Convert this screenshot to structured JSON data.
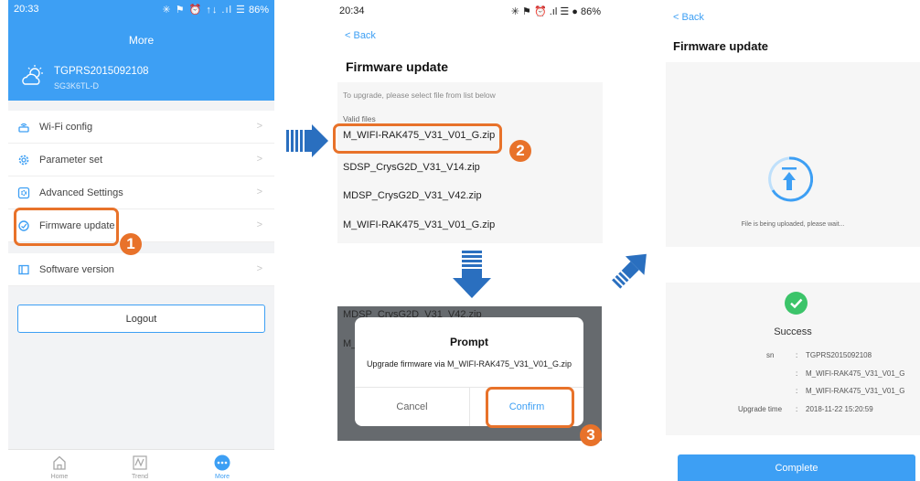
{
  "panel1": {
    "status": {
      "time": "20:33",
      "icons": "✳ ⚑ ⏰ ↑↓ .ıl ☰",
      "battery": "86%"
    },
    "title": "More",
    "device": {
      "sn": "TGPRS2015092108",
      "model": "SG3K6TL-D"
    },
    "menu": [
      {
        "label": "Wi-Fi config",
        "icon": "wifi-router-icon"
      },
      {
        "label": "Parameter set",
        "icon": "gear-icon"
      },
      {
        "label": "Advanced Settings",
        "icon": "advanced-gear-icon"
      },
      {
        "label": "Firmware update",
        "icon": "firmware-icon"
      }
    ],
    "software_version": "Software version",
    "logout": "Logout",
    "tabs": [
      {
        "label": "Home",
        "icon": "home-icon"
      },
      {
        "label": "Trend",
        "icon": "trend-icon"
      },
      {
        "label": "More",
        "icon": "more-icon"
      }
    ],
    "chevron": ">"
  },
  "panel2": {
    "status": {
      "time": "20:34",
      "icons": "✳ ⚑ ⏰ .ıl ☰ ●",
      "battery": "86%"
    },
    "back": "<  Back",
    "title": "Firmware update",
    "hint": "To upgrade, please select file from list below",
    "valid_files": "Valid files",
    "files": [
      "M_WIFI-RAK475_V31_V01_G.zip",
      "SDSP_CrysG2D_V31_V14.zip",
      "MDSP_CrysG2D_V31_V42.zip",
      "M_WIFI-RAK475_V31_V01_G.zip"
    ]
  },
  "panel3": {
    "bg_rows": [
      "MDSP_CrysG2D_V31_V42.zip",
      "M_"
    ],
    "dialog": {
      "title": "Prompt",
      "message": "Upgrade firmware via M_WIFI-RAK475_V31_V01_G.zip",
      "cancel": "Cancel",
      "confirm": "Confirm"
    }
  },
  "panel4": {
    "back": "<  Back",
    "title": "Firmware update",
    "uploading_text": "File is being uploaded, please wait...",
    "success": "Success",
    "details": [
      {
        "key": "sn",
        "sep": ":",
        "value": "TGPRS2015092108"
      },
      {
        "key": "",
        "sep": ":",
        "value": "M_WIFI-RAK475_V31_V01_G"
      },
      {
        "key": "",
        "sep": ":",
        "value": "M_WIFI-RAK475_V31_V01_G"
      },
      {
        "key": "Upgrade time",
        "sep": ":",
        "value": "2018-11-22 15:20:59"
      }
    ],
    "complete": "Complete"
  },
  "steps": [
    "1",
    "2",
    "3"
  ],
  "colors": {
    "accent": "#3d9ff4",
    "highlight": "#e8722a",
    "arrow": "#2a6fbf",
    "success": "#3cc46a"
  }
}
